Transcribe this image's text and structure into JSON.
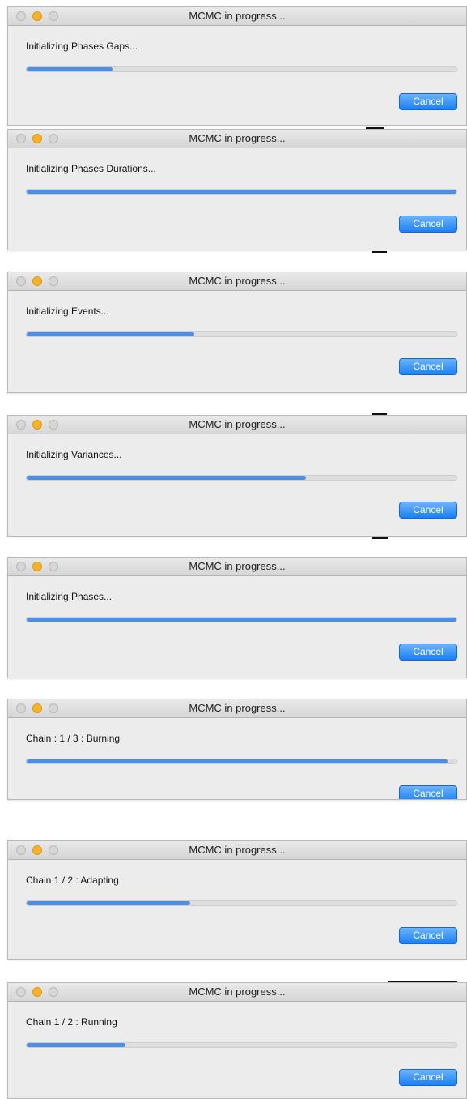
{
  "dialogs": [
    {
      "title": "MCMC in progress...",
      "status": "Initializing Phases Gaps...",
      "progress": 0.2,
      "cancel_label": "Cancel"
    },
    {
      "title": "MCMC in progress...",
      "status": "Initializing Phases Durations...",
      "progress": 1.0,
      "cancel_label": "Cancel"
    },
    {
      "title": "MCMC in progress...",
      "status": "Initializing Events...",
      "progress": 0.39,
      "cancel_label": "Cancel"
    },
    {
      "title": "MCMC in progress...",
      "status": "Initializing Variances...",
      "progress": 0.65,
      "cancel_label": "Cancel"
    },
    {
      "title": "MCMC in progress...",
      "status": "Initializing Phases...",
      "progress": 1.0,
      "cancel_label": "Cancel"
    },
    {
      "title": "MCMC in progress...",
      "status": "Chain : 1 / 3 : Burning",
      "progress": 0.98,
      "cancel_label": "Cancel"
    },
    {
      "title": "MCMC in progress...",
      "status": "Chain 1 / 2 : Adapting",
      "progress": 0.38,
      "cancel_label": "Cancel"
    },
    {
      "title": "MCMC in progress...",
      "status": "Chain 1 / 2 : Running",
      "progress": 0.23,
      "cancel_label": "Cancel"
    }
  ],
  "colors": {
    "progress_fill": "#4a8fe3",
    "progress_track": "#dedede",
    "cancel_button": "#1b7ff5",
    "minimize_button": "#f5b32a"
  }
}
